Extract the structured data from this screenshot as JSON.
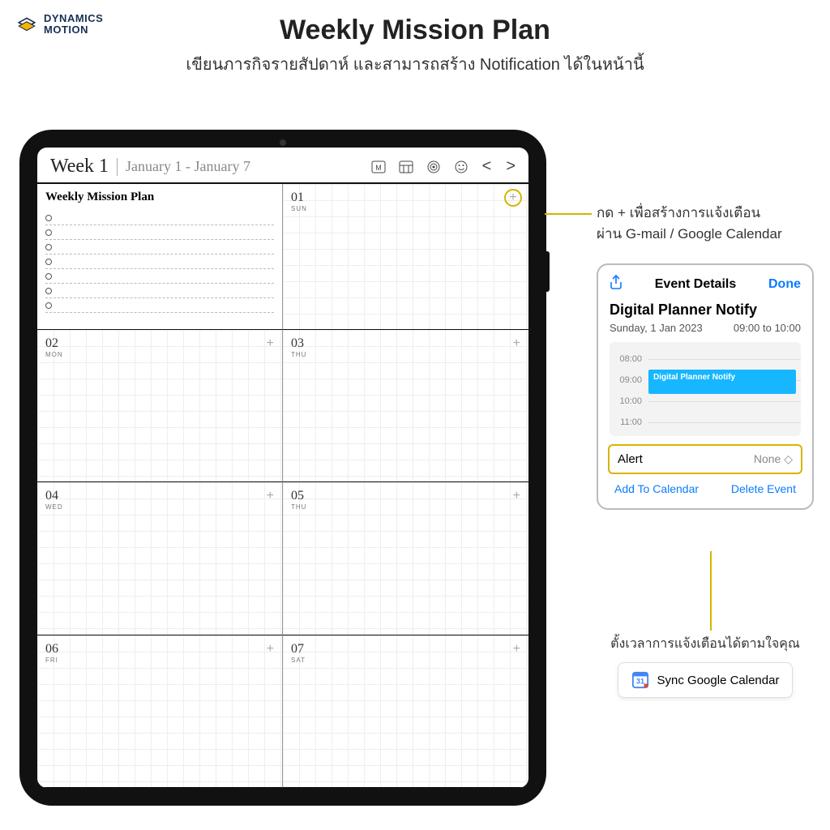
{
  "brand": {
    "line1": "DYNAMICS",
    "line2": "MOTION"
  },
  "header": {
    "title": "Weekly Mission Plan",
    "subtitle": "เขียนภารกิจรายสัปดาห์ และสามารถสร้าง Notification ได้ในหน้านี้"
  },
  "planner": {
    "week_label": "Week 1",
    "date_range": "January 1 - January 7",
    "mission_heading": "Weekly Mission Plan",
    "icons": {
      "month": "M",
      "prev": "<",
      "next": ">"
    },
    "days": [
      {
        "num": "01",
        "dow": "SUN"
      },
      {
        "num": "02",
        "dow": "MON"
      },
      {
        "num": "03",
        "dow": "THU"
      },
      {
        "num": "04",
        "dow": "WED"
      },
      {
        "num": "05",
        "dow": "THU"
      },
      {
        "num": "06",
        "dow": "FRI"
      },
      {
        "num": "07",
        "dow": "SAT"
      }
    ]
  },
  "callouts": {
    "plus_line1": "กด + เพื่อสร้างการแจ้งเตือน",
    "plus_line2": "ผ่าน G-mail / Google Calendar",
    "alert_note": "ตั้งเวลาการแจ้งเตือนได้ตามใจคุณ",
    "sync_label": "Sync Google Calendar",
    "gcal_day": "31"
  },
  "event_panel": {
    "title": "Event Details",
    "done": "Done",
    "name": "Digital Planner Notify",
    "date": "Sunday, 1 Jan 2023",
    "time": "09:00 to 10:00",
    "hours": [
      "08:00",
      "09:00",
      "10:00",
      "11:00"
    ],
    "block_label": "Digital Planner Notify",
    "alert_label": "Alert",
    "alert_value": "None ◇",
    "add": "Add To Calendar",
    "delete": "Delete Event"
  }
}
